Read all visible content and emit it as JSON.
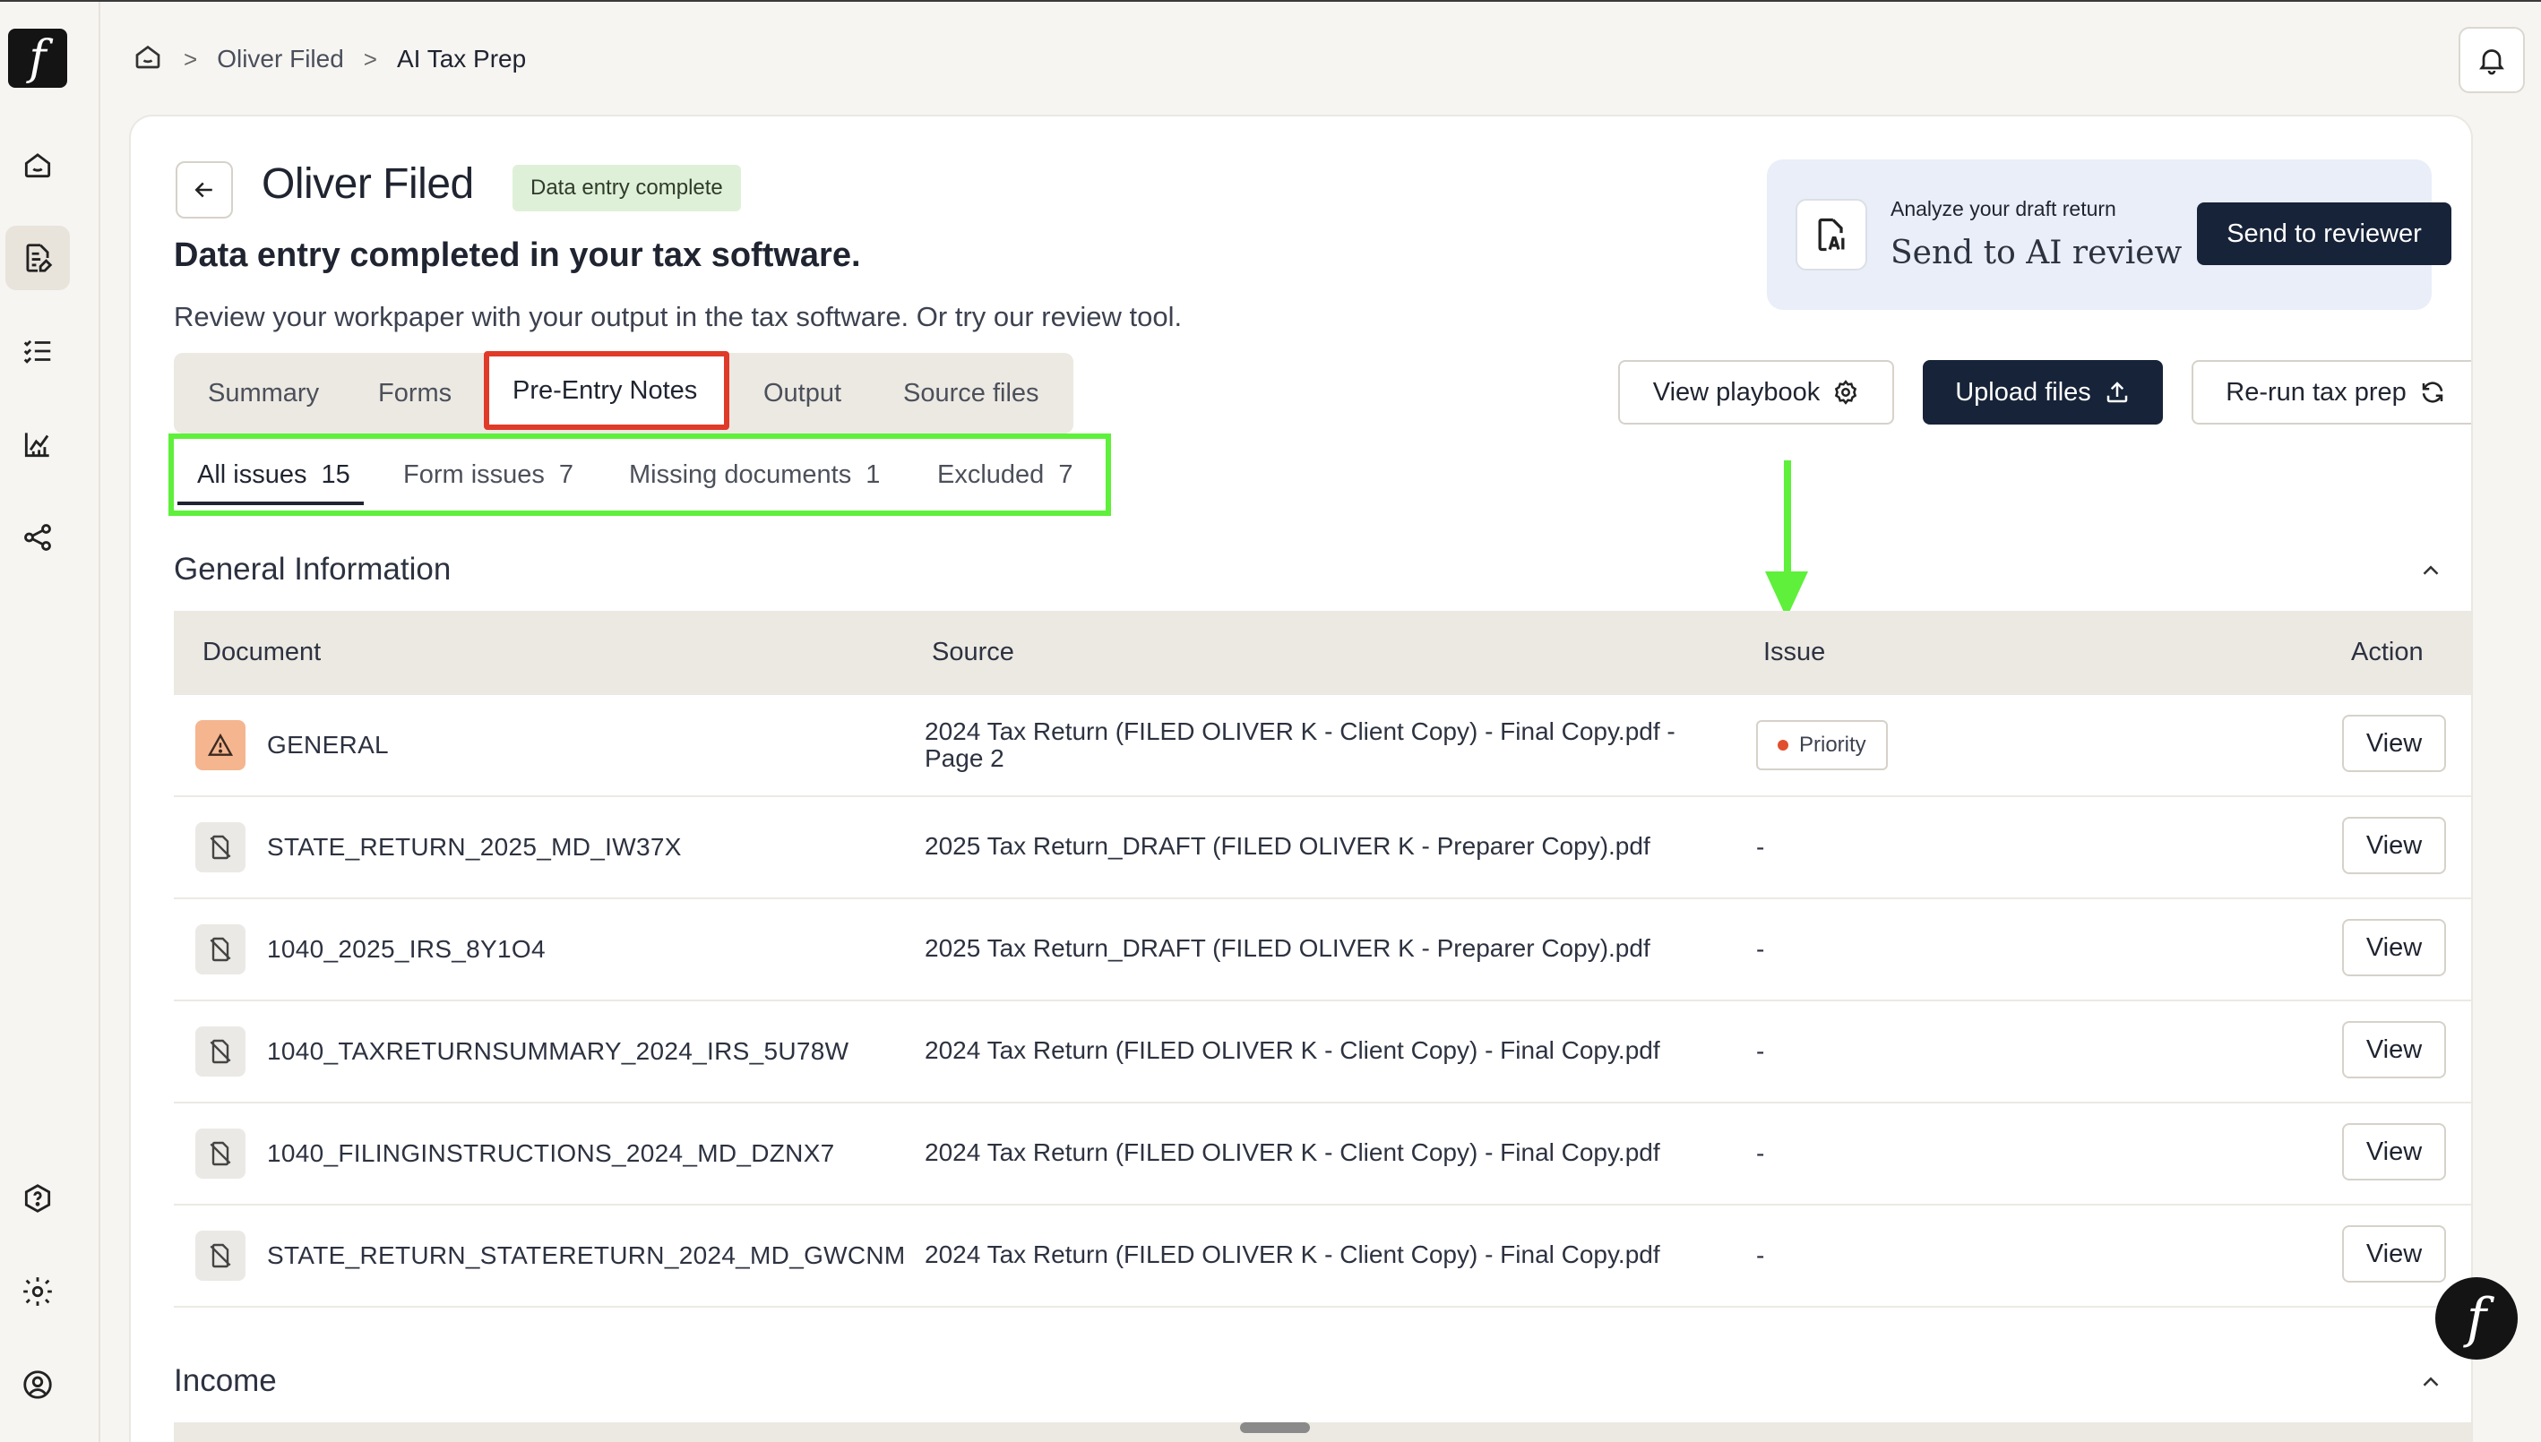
{
  "logo": {
    "glyph": "f"
  },
  "breadcrumb": {
    "items": [
      "Oliver Filed",
      "AI Tax Prep"
    ],
    "separator": ">"
  },
  "header": {
    "client_name": "Oliver Filed",
    "status_badge": "Data entry complete",
    "headline": "Data entry completed in your tax software.",
    "subline": "Review your workpaper with your output in the tax software. Or try our review tool."
  },
  "ai_panel": {
    "caption": "Analyze your draft return",
    "title": "Send to AI review",
    "button": "Send to reviewer"
  },
  "tabs": [
    {
      "label": "Summary"
    },
    {
      "label": "Forms"
    },
    {
      "label": "Pre-Entry Notes",
      "active": true
    },
    {
      "label": "Output"
    },
    {
      "label": "Source files"
    }
  ],
  "actions": {
    "playbook": "View playbook",
    "upload": "Upload files",
    "rerun": "Re-run tax prep"
  },
  "filters": [
    {
      "label": "All issues",
      "count": "15",
      "active": true
    },
    {
      "label": "Form issues",
      "count": "7"
    },
    {
      "label": "Missing documents",
      "count": "1"
    },
    {
      "label": "Excluded",
      "count": "7"
    }
  ],
  "section": {
    "title": "General Information",
    "columns": {
      "document": "Document",
      "source": "Source",
      "issue": "Issue",
      "action": "Action"
    },
    "rows": [
      {
        "document": "GENERAL",
        "source": "2024 Tax Return (FILED OLIVER K - Client Copy) - Final Copy.pdf - Page 2",
        "issue": "Priority",
        "action": "View",
        "icon": "warning-icon"
      },
      {
        "document": "STATE_RETURN_2025_MD_IW37X",
        "source": "2025 Tax Return_DRAFT (FILED OLIVER K - Preparer Copy).pdf",
        "issue": "-",
        "action": "View",
        "icon": "file-off-icon"
      },
      {
        "document": "1040_2025_IRS_8Y1O4",
        "source": "2025 Tax Return_DRAFT (FILED OLIVER K - Preparer Copy).pdf",
        "issue": "-",
        "action": "View",
        "icon": "file-off-icon"
      },
      {
        "document": "1040_TAXRETURNSUMMARY_2024_IRS_5U78W",
        "source": "2024 Tax Return (FILED OLIVER K - Client Copy) - Final Copy.pdf",
        "issue": "-",
        "action": "View",
        "icon": "file-off-icon"
      },
      {
        "document": "1040_FILINGINSTRUCTIONS_2024_MD_DZNX7",
        "source": "2024 Tax Return (FILED OLIVER K - Client Copy) - Final Copy.pdf",
        "issue": "-",
        "action": "View",
        "icon": "file-off-icon"
      },
      {
        "document": "STATE_RETURN_STATERETURN_2024_MD_GWCNM",
        "source": "2024 Tax Return (FILED OLIVER K - Client Copy) - Final Copy.pdf",
        "issue": "-",
        "action": "View",
        "icon": "file-off-icon"
      }
    ]
  },
  "section2": {
    "title": "Income"
  },
  "colors": {
    "primary_dark": "#172338",
    "status_badge_bg": "#dff0d9",
    "highlight_red": "#e03a28",
    "highlight_green": "#5ef03a",
    "priority_dot": "#e0502e"
  }
}
